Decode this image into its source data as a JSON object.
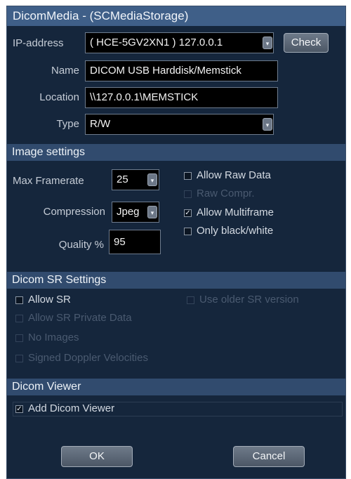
{
  "window": {
    "title": "DicomMedia - (SCMediaStorage)"
  },
  "connection": {
    "ip_label": "IP-address",
    "ip_value": "( HCE-5GV2XN1 ) 127.0.0.1",
    "check_label": "Check",
    "name_label": "Name",
    "name_value": "DICOM USB Harddisk/Memstick",
    "location_label": "Location",
    "location_value": "\\\\127.0.0.1\\MEMSTICK",
    "type_label": "Type",
    "type_value": "R/W"
  },
  "image_settings": {
    "header": "Image settings",
    "max_framerate_label": "Max Framerate",
    "max_framerate_value": "25",
    "compression_label": "Compression",
    "compression_value": "Jpeg",
    "quality_label": "Quality %",
    "quality_value": "95",
    "allow_raw_label": "Allow Raw Data",
    "allow_raw_checked": false,
    "raw_compr_label": "Raw Compr.",
    "raw_compr_checked": false,
    "allow_multiframe_label": "Allow Multiframe",
    "allow_multiframe_checked": true,
    "only_bw_label": "Only black/white",
    "only_bw_checked": false
  },
  "sr_settings": {
    "header": "Dicom SR Settings",
    "allow_sr_label": "Allow SR",
    "allow_sr_checked": false,
    "use_older_label": "Use older SR version",
    "allow_private_label": "Allow SR Private Data",
    "no_images_label": "No Images",
    "signed_doppler_label": "Signed Doppler Velocities"
  },
  "viewer": {
    "header": "Dicom Viewer",
    "add_viewer_label": "Add Dicom Viewer",
    "add_viewer_checked": true
  },
  "buttons": {
    "ok": "OK",
    "cancel": "Cancel"
  },
  "icons": {
    "dropdown": "chevron-down-icon",
    "check": "checkmark-icon"
  },
  "colors": {
    "background": "#15263c",
    "titlebar": "#3f5f88",
    "section": "#314b6e"
  }
}
